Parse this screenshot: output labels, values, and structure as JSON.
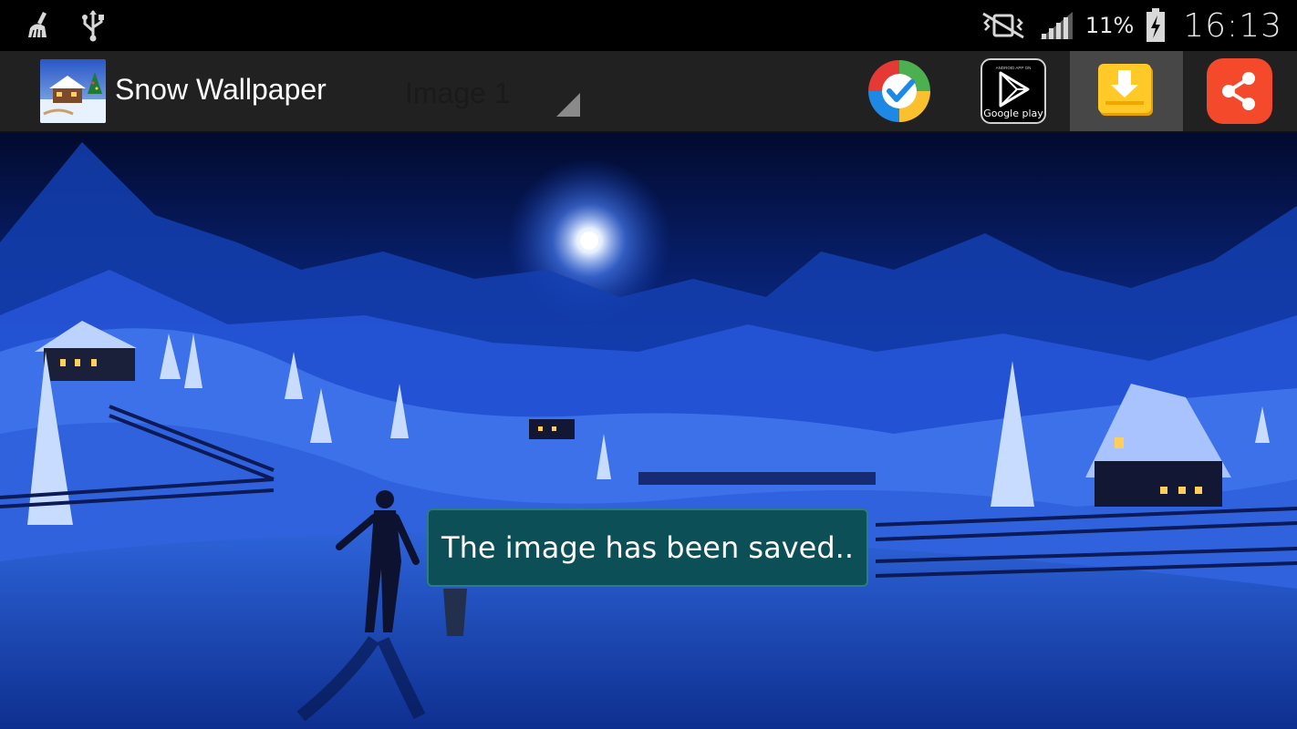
{
  "status_bar": {
    "left_icons": [
      "broom-icon",
      "usb-icon"
    ],
    "right_icons": [
      "vibrate-mute-icon",
      "signal-icon",
      "battery-charging-icon"
    ],
    "battery_percent": "11%",
    "time": "16:13"
  },
  "action_bar": {
    "app_title": "Snow Wallpaper",
    "spinner_selected": "Image 1",
    "buttons": [
      {
        "name": "set-wallpaper-button",
        "icon": "check-circle-icon"
      },
      {
        "name": "google-play-button",
        "icon": "google-play-icon",
        "caption": "Google play"
      },
      {
        "name": "save-image-button",
        "icon": "download-icon",
        "active": true
      },
      {
        "name": "share-button",
        "icon": "share-icon"
      }
    ]
  },
  "toast": {
    "message": "The image has been saved.."
  },
  "colors": {
    "status_bar_bg": "#000000",
    "action_bar_bg": "#212121",
    "active_button_bg": "#474747",
    "toast_bg": "#0c4f56"
  }
}
